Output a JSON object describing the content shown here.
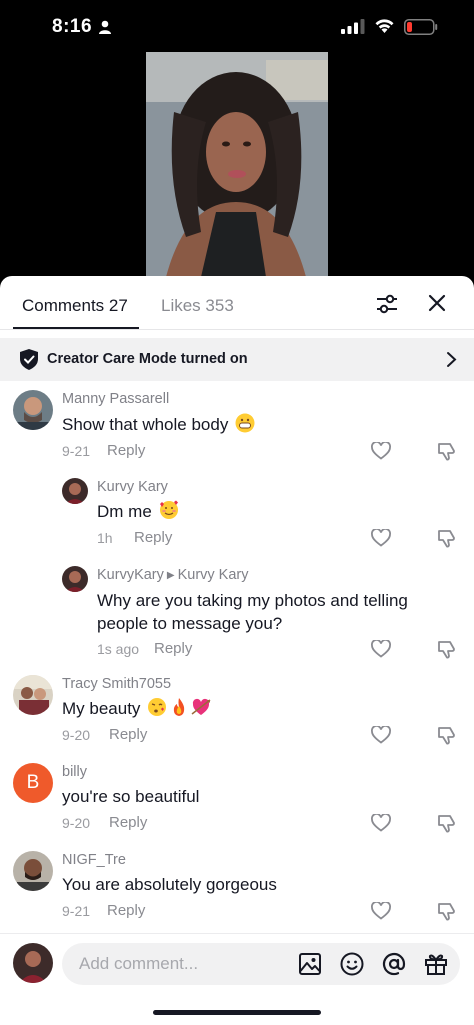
{
  "status_bar": {
    "time": "8:16"
  },
  "sheet": {
    "tabs": {
      "comments": "Comments 27",
      "likes": "Likes 353"
    },
    "care_banner": "Creator Care Mode turned on"
  },
  "comments": [
    {
      "username": "Manny Passarell",
      "text": "Show that whole body",
      "emojis": [
        "grin"
      ],
      "time": "9-21",
      "reply": "Reply"
    },
    {
      "username": "Kurvy Kary",
      "text": "Dm me",
      "emojis": [
        "smiling-hearts"
      ],
      "time": "1h",
      "reply": "Reply"
    },
    {
      "username": "KurvyKary",
      "reply_to": "Kurvy Kary",
      "text": "Why are you taking my photos and telling people to message you?",
      "time": "1s ago",
      "reply": "Reply"
    },
    {
      "username": "Tracy Smith7055",
      "text": "My beauty",
      "emojis": [
        "kiss",
        "fire",
        "heart-arrow"
      ],
      "time": "9-20",
      "reply": "Reply"
    },
    {
      "username": "billy",
      "avatar_letter": "B",
      "text": "you're so beautiful",
      "time": "9-20",
      "reply": "Reply"
    },
    {
      "username": "NIGF_Tre",
      "text": "You are absolutely gorgeous",
      "time": "9-21",
      "reply": "Reply"
    }
  ],
  "composer": {
    "placeholder": "Add comment..."
  },
  "colors": {
    "accent_avatar": "#ef5a2b",
    "text": "#161823",
    "muted": "#8a8b91"
  }
}
